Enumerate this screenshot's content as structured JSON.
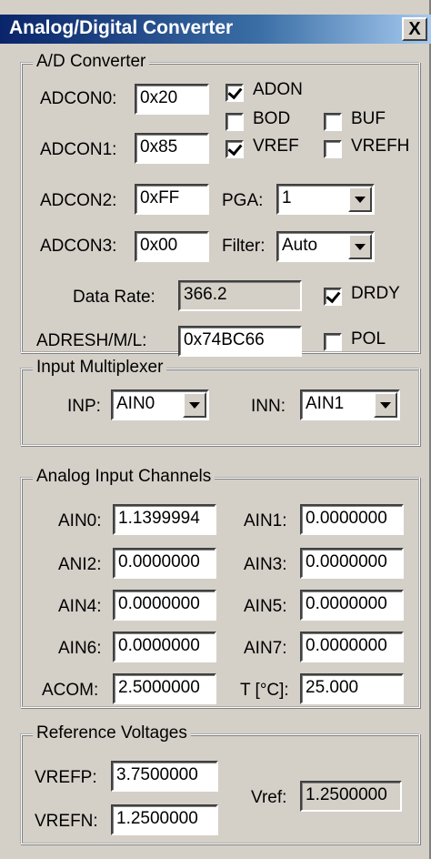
{
  "title": "Analog/Digital Converter",
  "close_label": "X",
  "ad": {
    "legend": "A/D Converter",
    "adcon0": {
      "label": "ADCON0:",
      "value": "0x20"
    },
    "adcon1": {
      "label": "ADCON1:",
      "value": "0x85"
    },
    "adcon2": {
      "label": "ADCON2:",
      "value": "0xFF"
    },
    "adcon3": {
      "label": "ADCON3:",
      "value": "0x00"
    },
    "adon": {
      "label": "ADON",
      "checked": true
    },
    "bod": {
      "label": "BOD",
      "checked": false
    },
    "buf": {
      "label": "BUF",
      "checked": false
    },
    "vref": {
      "label": "VREF",
      "checked": true
    },
    "vrefh": {
      "label": "VREFH",
      "checked": false
    },
    "pga": {
      "label": "PGA:",
      "value": "1"
    },
    "filter": {
      "label": "Filter:",
      "value": "Auto"
    },
    "data_rate": {
      "label": "Data Rate:",
      "value": "366.2"
    },
    "drdy": {
      "label": "DRDY",
      "checked": true
    },
    "adres": {
      "label": "ADRESH/M/L:",
      "value": "0x74BC66"
    },
    "pol": {
      "label": "POL",
      "checked": false
    }
  },
  "mux": {
    "legend": "Input Multiplexer",
    "inp": {
      "label": "INP:",
      "value": "AIN0"
    },
    "inn": {
      "label": "INN:",
      "value": "AIN1"
    }
  },
  "channels": {
    "legend": "Analog Input Channels",
    "ain0": {
      "label": "AIN0:",
      "value": "1.1399994"
    },
    "ain1": {
      "label": "AIN1:",
      "value": "0.0000000"
    },
    "ani2": {
      "label": "ANI2:",
      "value": "0.0000000"
    },
    "ain3": {
      "label": "AIN3:",
      "value": "0.0000000"
    },
    "ain4": {
      "label": "AIN4:",
      "value": "0.0000000"
    },
    "ain5": {
      "label": "AIN5:",
      "value": "0.0000000"
    },
    "ain6": {
      "label": "AIN6:",
      "value": "0.0000000"
    },
    "ain7": {
      "label": "AIN7:",
      "value": "0.0000000"
    },
    "acom": {
      "label": "ACOM:",
      "value": "2.5000000"
    },
    "temp": {
      "label": "T [°C]:",
      "value": "25.000"
    }
  },
  "ref": {
    "legend": "Reference Voltages",
    "vrefp": {
      "label": "VREFP:",
      "value": "3.7500000"
    },
    "vrefn": {
      "label": "VREFN:",
      "value": "1.2500000"
    },
    "vref": {
      "label": "Vref:",
      "value": "1.2500000"
    }
  }
}
